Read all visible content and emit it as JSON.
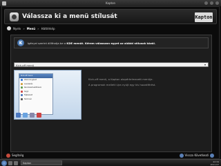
{
  "window": {
    "title": "Kapton"
  },
  "header": {
    "title": "Válassza ki a menü stílusát",
    "logo": "Kapton"
  },
  "breadcrumb": {
    "items": [
      "Nyelv",
      "Menü",
      "Háttérkép"
    ],
    "current_index": 1,
    "separator": "»"
  },
  "info": {
    "prefix": "Igényei szerint állíthatja be a ",
    "highlight": "KDE menüt.",
    "suffix": " Kérem válasszon egyet az alábbi stílusok közül.",
    "icon": "kde-icon"
  },
  "combo": {
    "value": "Kick-off menü"
  },
  "preview": {
    "window_title": "Kick-off menü",
    "rows": [
      {
        "label": "Web böngésző",
        "color": "#3b7bd6"
      },
      {
        "label": "Levelezés",
        "color": "#d0a040"
      },
      {
        "label": "Rendszerbeállítások",
        "color": "#5f9d4d"
      },
      {
        "label": "Súgó",
        "color": "#c44"
      },
      {
        "label": "Fájlkezelő",
        "color": "#4a77c0"
      },
      {
        "label": "Terminál",
        "color": "#555"
      }
    ],
    "footer_colors": [
      "#4a77c0",
      "#6aa3e0",
      "#8888aa",
      "#cc4444"
    ]
  },
  "description": {
    "line1": "Kick-off menü, a Kapton alapértelmezett menüje.",
    "line2": "A programok mellett újra nyújt egy kis hozzáférést."
  },
  "buttons": {
    "help": "Segítség",
    "back": "Vissza",
    "next": "Következő"
  },
  "taskbar": {
    "task_label": "Kapton",
    "time": "22:34",
    "date": "2011.07"
  }
}
